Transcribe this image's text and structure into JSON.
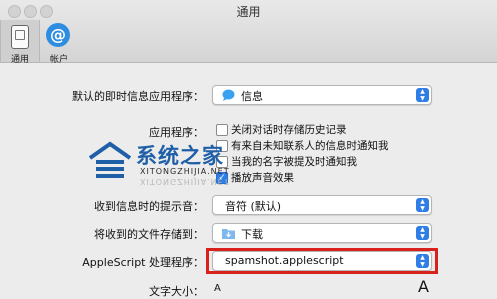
{
  "window": {
    "title": "通用"
  },
  "toolbar": {
    "items": [
      {
        "label": "通用",
        "icon": "general-icon",
        "selected": true
      },
      {
        "label": "帐户",
        "icon": "at-sign-icon",
        "selected": false
      }
    ]
  },
  "settings": {
    "default_app_label": "默认的即时信息应用程序：",
    "default_app_value": "信息",
    "application_label": "应用程序：",
    "checkboxes": [
      {
        "label": "关闭对话时存储历史记录",
        "checked": false
      },
      {
        "label": "有来自未知联系人的信息时通知我",
        "checked": false
      },
      {
        "label": "当我的名字被提及时通知我",
        "checked": false
      },
      {
        "label": "播放声音效果",
        "checked": true
      }
    ],
    "alert_sound_label": "收到信息时的提示音：",
    "alert_sound_value": "音符 (默认)",
    "save_files_label": "将收到的文件存储到：",
    "save_files_value": "下载",
    "applescript_label": "AppleScript 处理程序：",
    "applescript_value": "spamshot.applescript",
    "text_size_label": "文字大小：",
    "text_size_small": "A",
    "text_size_large": "A"
  },
  "watermark": {
    "title": "系统之家",
    "subtitle": "XITONGZHIJIA.NET",
    "mirror": "XITONGZHIJIA.NET"
  },
  "colors": {
    "accent": "#2f7ee6",
    "highlight": "#d8201c",
    "watermark": "#1e5fa8"
  }
}
